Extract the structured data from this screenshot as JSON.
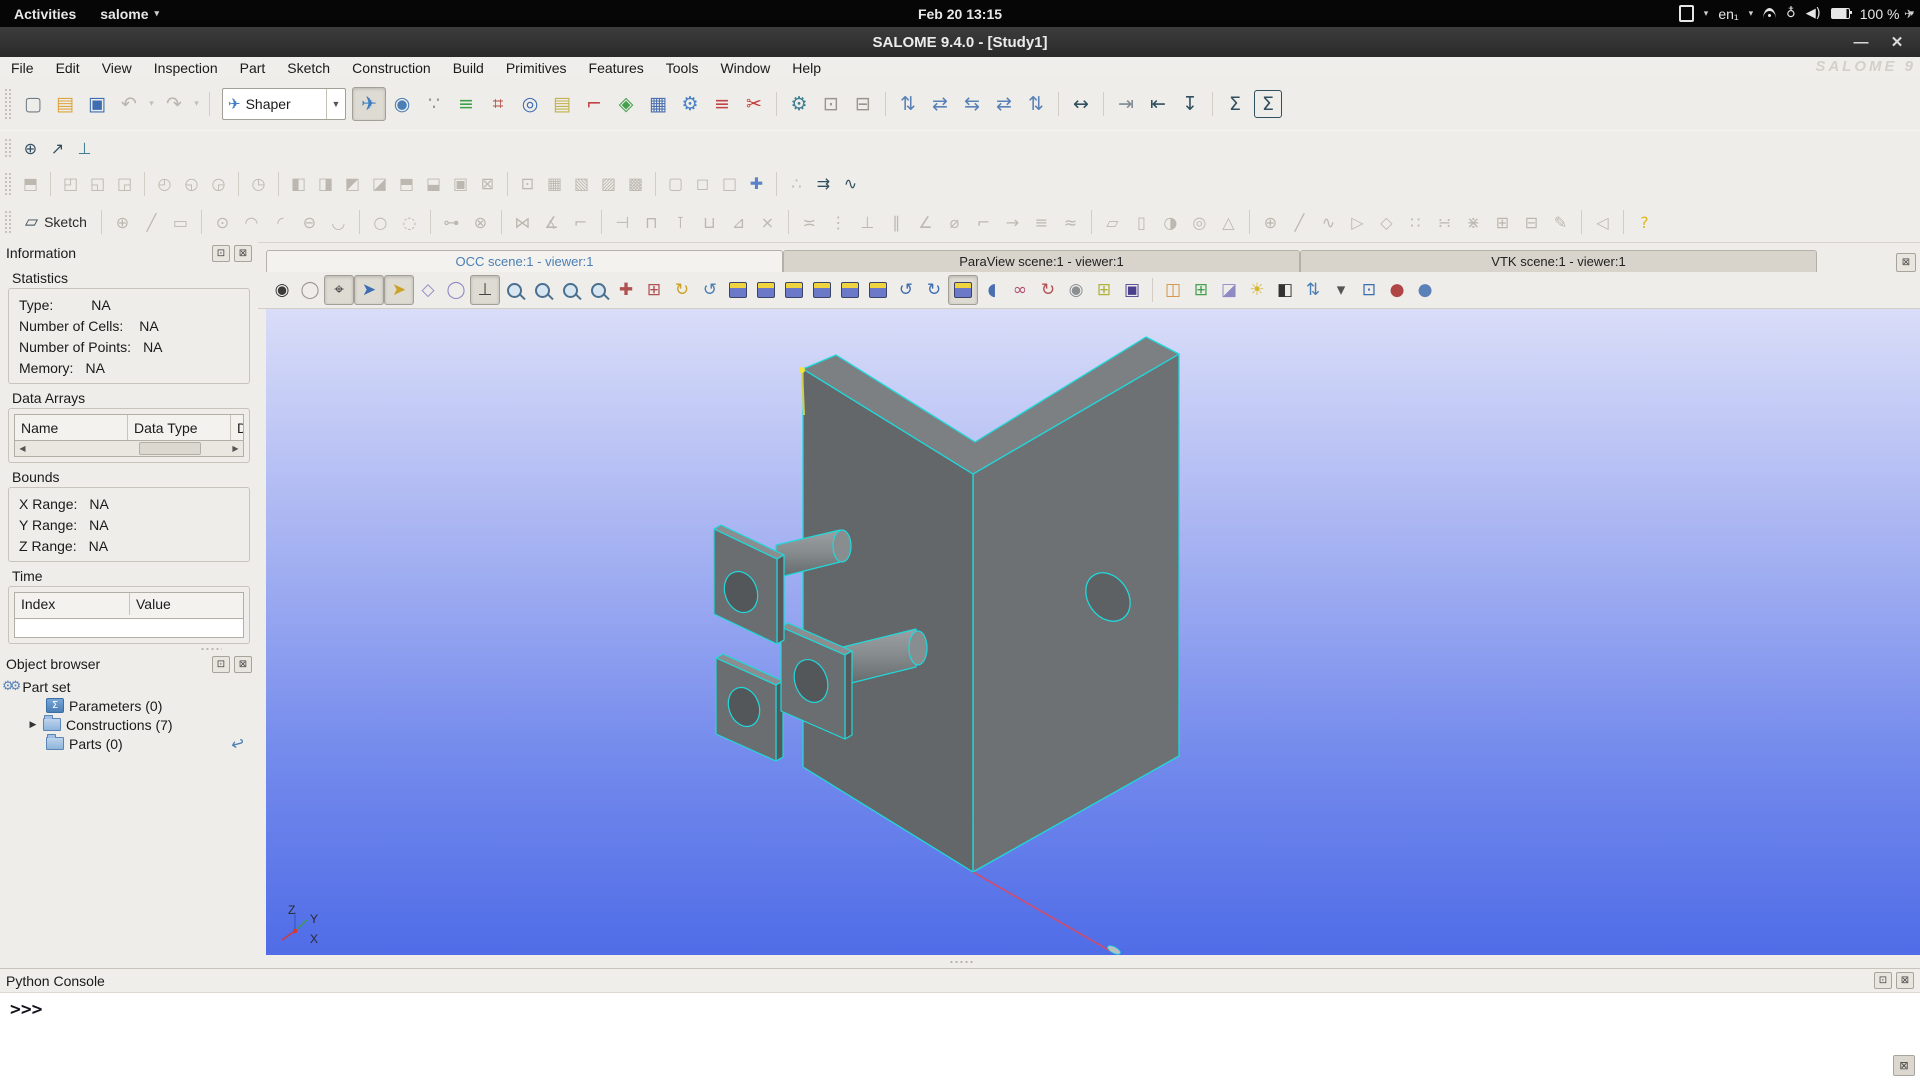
{
  "topbar": {
    "activities": "Activities",
    "app": "salome",
    "clock": "Feb 20  13:15",
    "layout": "en₁",
    "battery": "100 %"
  },
  "window": {
    "title": "SALOME  9.4.0 - [Study1]",
    "watermark": "SALOME 9",
    "module": "Shaper",
    "sketch": "Sketch"
  },
  "menus": [
    "File",
    "Edit",
    "View",
    "Inspection",
    "Part",
    "Sketch",
    "Construction",
    "Build",
    "Primitives",
    "Features",
    "Tools",
    "Window",
    "Help"
  ],
  "colors": {
    "selection_cyan": "#1fd9db",
    "model_gray": "#6b6f71",
    "viewer_top": "#d9ddf8",
    "viewer_bottom": "#4f6ce7",
    "highlight_yellow": "#f2e63e",
    "construction_red": "#d84a64",
    "active_tab_text": "#4a7fb5"
  },
  "toolbars": {
    "main_a": [
      {
        "name": "new-document-icon",
        "g": "▢",
        "c": "#6f7d88"
      },
      {
        "name": "open-folder-icon",
        "g": "▤",
        "c": "#dda43f"
      },
      {
        "name": "save-icon",
        "g": "▣",
        "c": "#3e6db2"
      },
      {
        "name": "undo-icon",
        "g": "↶",
        "c": "#b9b5ad"
      },
      {
        "name": "undo-dropdown-icon",
        "g": "▾",
        "c": "#c3bfb7",
        "n": true
      },
      {
        "name": "redo-icon",
        "g": "↷",
        "c": "#b9b5ad"
      },
      {
        "name": "redo-dropdown-icon",
        "g": "▾",
        "c": "#c3bfb7",
        "n": true
      },
      {
        "sep": true
      }
    ],
    "main_b": [
      {
        "name": "shaper-module-icon",
        "g": "✈",
        "c": "#3e7fc4",
        "p": true
      },
      {
        "name": "mesh-sphere-icon",
        "g": "◉",
        "c": "#4a7fb5"
      },
      {
        "name": "footprint-icon",
        "g": "∵",
        "c": "#9a958d"
      },
      {
        "name": "paravis-icon",
        "g": "≡",
        "c": "#3fa04a"
      },
      {
        "name": "network-icon",
        "g": "⌗",
        "c": "#b04a3f"
      },
      {
        "name": "globe-icon",
        "g": "◎",
        "c": "#3e6db2"
      },
      {
        "name": "calculator-icon",
        "g": "▤",
        "c": "#c2b24f"
      },
      {
        "name": "measure-icon",
        "g": "⌐",
        "c": "#c04545"
      },
      {
        "name": "geometry-cube-icon",
        "g": "◈",
        "c": "#46a04e"
      },
      {
        "name": "blocs-icon",
        "g": "▦",
        "c": "#4a6fb0"
      },
      {
        "name": "mesh-gear-icon",
        "g": "⚙",
        "c": "#4a82c4"
      },
      {
        "name": "ruler-icon",
        "g": "≡",
        "c": "#c04545"
      },
      {
        "name": "scissors-icon",
        "g": "✂",
        "c": "#c23a3a"
      },
      {
        "sep": true
      },
      {
        "name": "preferences-gear-icon",
        "g": "⚙",
        "c": "#3e7f93"
      },
      {
        "name": "copy-icon",
        "g": "⊡",
        "c": "#9a958d"
      },
      {
        "name": "delete-icon",
        "g": "⊟",
        "c": "#9a958d"
      },
      {
        "sep": true
      },
      {
        "name": "arrange-up-icon",
        "g": "⇅",
        "c": "#5a82b8"
      },
      {
        "name": "arrange-down-icon",
        "g": "⇄",
        "c": "#5a82b8"
      },
      {
        "name": "arrange-left-icon",
        "g": "⇆",
        "c": "#5a82b8"
      },
      {
        "name": "arrange-right-icon",
        "g": "⇄",
        "c": "#5a82b8"
      },
      {
        "name": "arrange-sync-icon",
        "g": "⇅",
        "c": "#5a82b8"
      },
      {
        "sep": true
      },
      {
        "name": "fit-range-icon",
        "g": "↔",
        "c": "#31505f"
      },
      {
        "sep": true
      },
      {
        "name": "import-icon",
        "g": "⇥",
        "c": "#7f8a94"
      },
      {
        "name": "export-icon",
        "g": "⇤",
        "c": "#31505f"
      },
      {
        "name": "dump-study-icon",
        "g": "↧",
        "c": "#31505f"
      },
      {
        "sep": true
      },
      {
        "name": "sum-icon",
        "g": "Σ",
        "c": "#31505f"
      },
      {
        "name": "notebook-sum-icon",
        "g": "Σ",
        "c": "#31505f",
        "b": true
      }
    ],
    "small": [
      {
        "name": "measure-point-icon",
        "g": "⊕",
        "c": "#31505f"
      },
      {
        "name": "vector-icon",
        "g": "↗",
        "c": "#31505f"
      },
      {
        "name": "normal-plane-icon",
        "g": "⊥",
        "c": "#3f7f8f"
      }
    ],
    "features": [
      {
        "name": "new-part-icon",
        "g": "⬒"
      },
      {
        "sep": true
      },
      {
        "name": "export-part-icon",
        "g": "◰"
      },
      {
        "name": "import-part-icon",
        "g": "◱"
      },
      {
        "name": "save-part-icon",
        "g": "◲"
      },
      {
        "sep": true
      },
      {
        "name": "translation-icon",
        "g": "◴"
      },
      {
        "name": "rotation-icon",
        "g": "◵"
      },
      {
        "name": "symmetry-icon",
        "g": "◶"
      },
      {
        "sep": true
      },
      {
        "name": "recover-icon",
        "g": "◷"
      },
      {
        "sep": true
      },
      {
        "name": "fuse-icon",
        "g": "◧"
      },
      {
        "name": "common-icon",
        "g": "◨"
      },
      {
        "name": "cut-icon",
        "g": "◩"
      },
      {
        "name": "smash-icon",
        "g": "◪"
      },
      {
        "name": "split-icon",
        "g": "⬒"
      },
      {
        "name": "partition-icon",
        "g": "⬓"
      },
      {
        "name": "intersection-icon",
        "g": "▣"
      },
      {
        "name": "union-icon",
        "g": "⊠"
      },
      {
        "sep": true
      },
      {
        "name": "shared-faces-icon",
        "g": "⊡"
      },
      {
        "name": "group-icon",
        "g": "▦"
      },
      {
        "name": "group-addition-icon",
        "g": "▧"
      },
      {
        "name": "group-substraction-icon",
        "g": "▨"
      },
      {
        "name": "group-intersection-icon",
        "g": "▩"
      },
      {
        "sep": true
      },
      {
        "name": "fillet-icon",
        "g": "▢"
      },
      {
        "name": "chamfer-icon",
        "g": "◻"
      },
      {
        "name": "defeaturing-icon",
        "g": "□"
      },
      {
        "name": "macro-icon",
        "g": "✚",
        "c": "#5a82c8"
      },
      {
        "sep": true
      },
      {
        "name": "points-cloud-icon",
        "g": "∴"
      },
      {
        "name": "export-to-geom-icon",
        "g": "⇉",
        "c": "#31505f"
      },
      {
        "name": "selection-lasso-icon",
        "g": "∿",
        "c": "#31505f"
      }
    ],
    "sketch": [
      {
        "name": "sketch-point-icon",
        "g": "⊕"
      },
      {
        "name": "sketch-line-icon",
        "g": "╱"
      },
      {
        "name": "sketch-rectangle-icon",
        "g": "▭"
      },
      {
        "sep": true
      },
      {
        "name": "sketch-circle-icon",
        "g": "⊙"
      },
      {
        "name": "sketch-arc-icon",
        "g": "◠"
      },
      {
        "name": "sketch-tangent-arc-icon",
        "g": "◜"
      },
      {
        "name": "sketch-ellipse-icon",
        "g": "⊖"
      },
      {
        "name": "sketch-elliptic-arc-icon",
        "g": "◡"
      },
      {
        "sep": true
      },
      {
        "name": "sketch-circle-3pt-icon",
        "g": "○"
      },
      {
        "name": "sketch-arc-3pt-icon",
        "g": "◌"
      },
      {
        "sep": true
      },
      {
        "name": "sketch-projection-icon",
        "g": "⊶"
      },
      {
        "name": "sketch-intersection-icon",
        "g": "⊗"
      },
      {
        "sep": true
      },
      {
        "name": "sketch-mirror-icon",
        "g": "⋈"
      },
      {
        "name": "sketch-angular-copy-icon",
        "g": "∡"
      },
      {
        "name": "sketch-linear-copy-icon",
        "g": "⌐"
      },
      {
        "sep": true
      },
      {
        "name": "sketch-horizontal-distance-icon",
        "g": "⊣"
      },
      {
        "name": "sketch-distance-icon",
        "g": "⊓"
      },
      {
        "name": "sketch-vertical-distance-icon",
        "g": "⊺"
      },
      {
        "name": "sketch-length-icon",
        "g": "⊔"
      },
      {
        "name": "sketch-angle-dim-icon",
        "g": "⊿"
      },
      {
        "name": "sketch-trim-icon",
        "g": "×"
      },
      {
        "sep": true
      },
      {
        "name": "sketch-horizontal-constraint-icon",
        "g": "≍"
      },
      {
        "name": "sketch-vertical-constraint-icon",
        "g": "⋮"
      },
      {
        "name": "sketch-perpendicular-icon",
        "g": "⊥"
      },
      {
        "name": "sketch-parallel-icon",
        "g": "∥"
      },
      {
        "name": "sketch-angle-constraint-icon",
        "g": "∠"
      },
      {
        "name": "sketch-radius-icon",
        "g": "⌀"
      },
      {
        "name": "sketch-tangent-icon",
        "g": "⌐"
      },
      {
        "name": "sketch-middle-point-icon",
        "g": "→"
      },
      {
        "name": "sketch-equal-icon",
        "g": "≡"
      },
      {
        "name": "sketch-collinear-icon",
        "g": "≈"
      },
      {
        "sep": true
      },
      {
        "name": "box-icon",
        "g": "▱"
      },
      {
        "name": "cylinder-icon",
        "g": "▯"
      },
      {
        "name": "sphere-icon",
        "g": "◑"
      },
      {
        "name": "torus-icon",
        "g": "◎"
      },
      {
        "name": "cone-icon",
        "g": "△"
      },
      {
        "sep": true
      },
      {
        "name": "point-3d-icon",
        "g": "⊕"
      },
      {
        "name": "line-3d-icon",
        "g": "╱"
      },
      {
        "name": "polyline-icon",
        "g": "∿"
      },
      {
        "name": "closed-polyline-icon",
        "g": "▷"
      },
      {
        "name": "polygon-icon",
        "g": "◇"
      },
      {
        "name": "vertex-group-icon",
        "g": "∷"
      },
      {
        "name": "edge-group-icon",
        "g": "∺"
      },
      {
        "name": "wire-group-icon",
        "g": "⋇"
      },
      {
        "name": "face-group-icon",
        "g": "⊞"
      },
      {
        "name": "shell-group-icon",
        "g": "⊟"
      },
      {
        "name": "edit-feature-icon",
        "g": "✎"
      },
      {
        "sep": true
      },
      {
        "name": "face-selection-icon",
        "g": "◁"
      },
      {
        "sep": true
      },
      {
        "name": "help-icon",
        "g": "?",
        "c": "#e0b81f"
      }
    ],
    "viewer": [
      {
        "name": "dump-view-icon",
        "g": "◉",
        "c": "#3a3a3a"
      },
      {
        "name": "mouse-style-icon",
        "g": "◯",
        "c": "#9a958d"
      },
      {
        "name": "interaction-style-icon",
        "g": "⌖",
        "c": "#444444",
        "p": true
      },
      {
        "name": "preselection-icon",
        "g": "➤",
        "c": "#3e6db2",
        "p": true
      },
      {
        "name": "selection-icon",
        "g": "➤",
        "c": "#c9a227",
        "p": true
      },
      {
        "name": "polygon-selection-icon",
        "g": "◇",
        "c": "#8f89c4"
      },
      {
        "name": "circle-selection-icon",
        "g": "◯",
        "c": "#8f89c4"
      },
      {
        "name": "show-trihedron-icon",
        "g": "⊥",
        "c": "#444444",
        "p": true
      },
      {
        "name": "fit-all-icon",
        "t": "mag"
      },
      {
        "name": "fit-area-icon",
        "t": "mag"
      },
      {
        "name": "zoom-icon",
        "t": "mag"
      },
      {
        "name": "magnifier-icon",
        "t": "mag"
      },
      {
        "name": "pan-icon",
        "g": "✚",
        "c": "#b05050"
      },
      {
        "name": "global-pan-icon",
        "g": "⊞",
        "c": "#b05050"
      },
      {
        "name": "change-rotation-point-icon",
        "g": "↻",
        "c": "#c9a227"
      },
      {
        "name": "rotate-icon",
        "g": "↺",
        "c": "#4a7fb5"
      },
      {
        "name": "front-view-icon",
        "t": "cube"
      },
      {
        "name": "back-view-icon",
        "t": "cube"
      },
      {
        "name": "top-view-icon",
        "t": "cube"
      },
      {
        "name": "bottom-view-icon",
        "t": "cube"
      },
      {
        "name": "left-view-icon",
        "t": "cube"
      },
      {
        "name": "right-view-icon",
        "t": "cube"
      },
      {
        "name": "rotate-left-icon",
        "g": "↺",
        "c": "#3e6db2"
      },
      {
        "name": "rotate-right-icon",
        "g": "↻",
        "c": "#3e6db2"
      },
      {
        "name": "isometric-view-icon",
        "t": "cube",
        "p": true
      },
      {
        "name": "shading-mode-icon",
        "g": "◖",
        "c": "#4a6fb0"
      },
      {
        "name": "anaglyph-icon",
        "g": "∞",
        "c": "#b04a6f"
      },
      {
        "name": "reset-view-icon",
        "g": "↻",
        "c": "#b05050"
      },
      {
        "name": "camera-icon",
        "g": "◉",
        "c": "#8a8f94"
      },
      {
        "name": "spreadsheet-icon",
        "g": "⊞",
        "c": "#aeb43f"
      },
      {
        "name": "python-trace-icon",
        "g": "▣",
        "c": "#4a3f8f"
      },
      {
        "sep": true
      },
      {
        "name": "mirror-view-icon",
        "g": "◫",
        "c": "#d09040"
      },
      {
        "name": "measure-box-icon",
        "g": "⊞",
        "c": "#46a04e"
      },
      {
        "name": "clipping-icon",
        "g": "◪",
        "c": "#8f89c4"
      },
      {
        "name": "lighting-icon",
        "g": "☀",
        "c": "#d4b62f"
      },
      {
        "name": "background-icon",
        "g": "◧",
        "c": "#333333"
      },
      {
        "name": "scaling-icon",
        "g": "⇅",
        "c": "#4a7fb5"
      },
      {
        "name": "scaling-dropdown-icon",
        "g": "▾",
        "c": "#555555",
        "n": true
      },
      {
        "name": "sync-views-icon",
        "g": "⊡",
        "c": "#3e6db2"
      },
      {
        "name": "ray-tracing-icon",
        "g": "●",
        "c": "#b04545"
      },
      {
        "name": "ambient-sphere-icon",
        "g": "●",
        "c": "#5a82b8"
      }
    ]
  },
  "information": {
    "title": "Information",
    "statistics": {
      "label": "Statistics",
      "rows": [
        {
          "label": "Type:",
          "value": "NA"
        },
        {
          "label": "Number of Cells:",
          "value": "NA"
        },
        {
          "label": "Number of Points:",
          "value": "NA"
        },
        {
          "label": "Memory:",
          "value": "NA"
        }
      ]
    },
    "data_arrays": {
      "label": "Data Arrays",
      "columns": [
        "Name",
        "Data Type",
        "Dat"
      ]
    },
    "bounds": {
      "label": "Bounds",
      "rows": [
        {
          "label": "X Range:",
          "value": "NA"
        },
        {
          "label": "Y Range:",
          "value": "NA"
        },
        {
          "label": "Z Range:",
          "value": "NA"
        }
      ]
    },
    "time": {
      "label": "Time",
      "columns": [
        "Index",
        "Value"
      ]
    }
  },
  "object_browser": {
    "title": "Object browser",
    "root": {
      "label": "Part set"
    },
    "items": [
      {
        "label": "Parameters (0)",
        "badge": "Σ"
      },
      {
        "label": "Constructions (7)"
      },
      {
        "label": "Parts (0)"
      }
    ]
  },
  "viewer": {
    "tabs": [
      {
        "label": "OCC scene:1 - viewer:1"
      },
      {
        "label": "ParaView scene:1 - viewer:1"
      },
      {
        "label": "VTK scene:1 - viewer:1"
      }
    ],
    "triad": {
      "x": "X",
      "y": "Y",
      "z": "Z"
    }
  },
  "console": {
    "title": "Python Console",
    "prompt": ">>>"
  }
}
